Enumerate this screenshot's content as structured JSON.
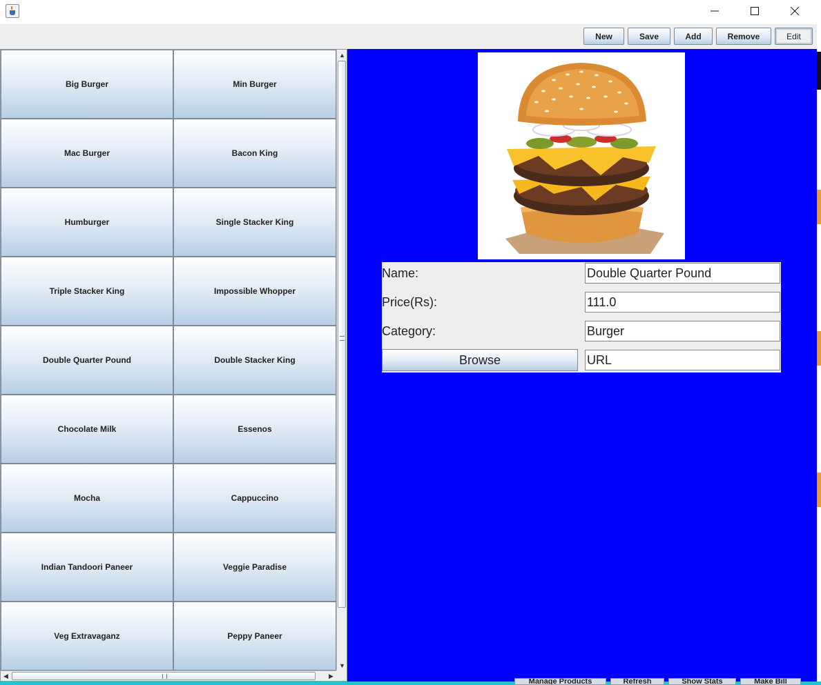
{
  "window": {
    "controls": {
      "minimize": "minimize-icon",
      "maximize": "maximize-icon",
      "close": "close-icon"
    }
  },
  "toolbar": {
    "new_label": "New",
    "save_label": "Save",
    "add_label": "Add",
    "remove_label": "Remove",
    "edit_label": "Edit"
  },
  "products": [
    "Big Burger",
    "Min Burger",
    "Mac Burger",
    "Bacon King",
    "Humburger",
    "Single Stacker King",
    "Triple Stacker King",
    "Impossible Whopper",
    "Double Quarter Pound",
    "Double Stacker King",
    "Chocolate Milk",
    "Essenos",
    "Mocha",
    "Cappuccino",
    "Indian Tandoori Paneer",
    "Veggie Paradise",
    "Veg Extravaganz",
    "Peppy Paneer"
  ],
  "detail": {
    "name_label": "Name:",
    "name_value": "Double Quarter Pound",
    "price_label": "Price(Rs):",
    "price_value": "111.0",
    "category_label": "Category:",
    "category_value": "Burger",
    "browse_label": "Browse",
    "url_value": "URL",
    "panel_color": "#0000ff"
  },
  "background_window": {
    "tabs": [
      "Manage Products",
      "Refresh",
      "Show Stats",
      "Make Bill"
    ]
  }
}
